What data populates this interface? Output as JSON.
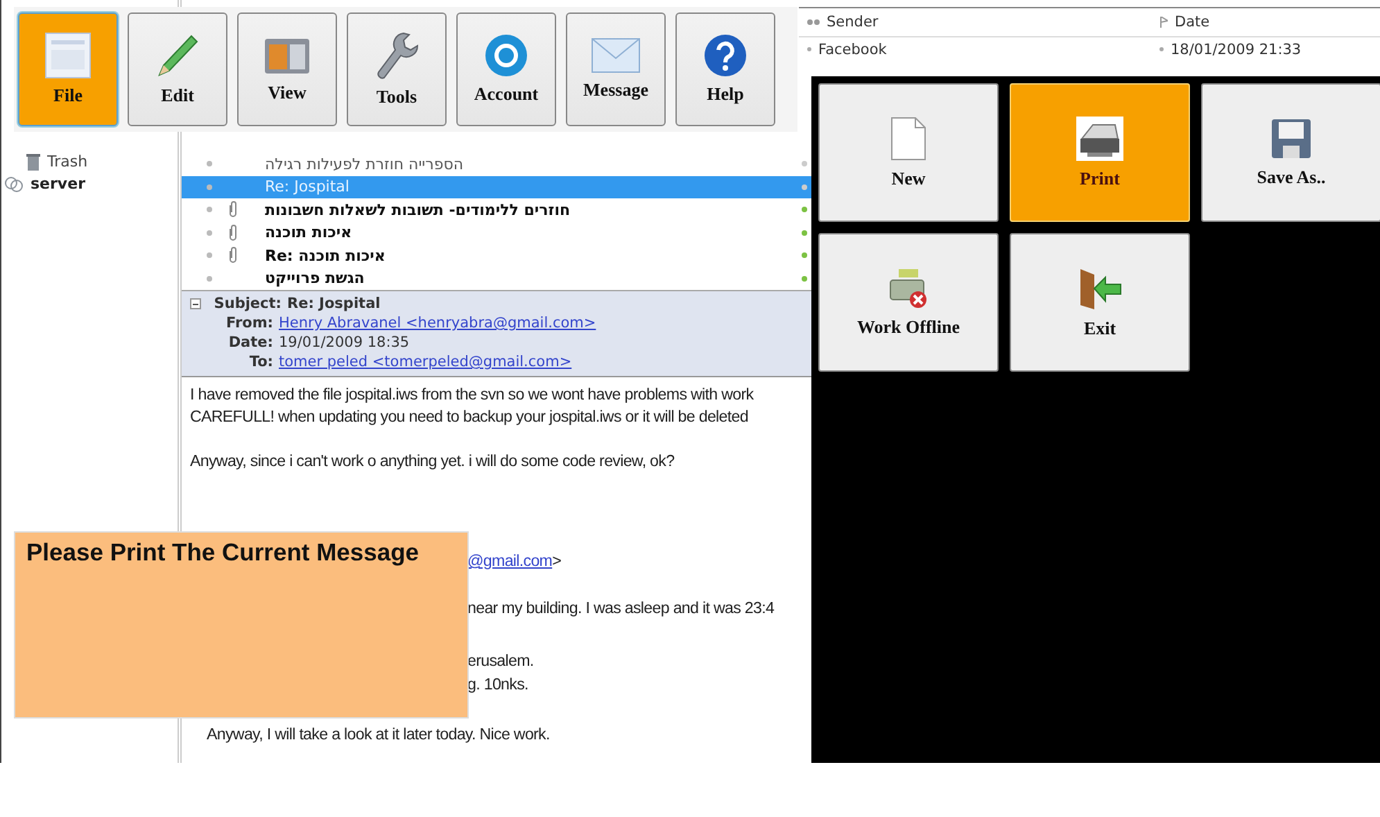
{
  "toolbar": [
    {
      "label": "File",
      "selected": true
    },
    {
      "label": "Edit",
      "selected": false
    },
    {
      "label": "View",
      "selected": false
    },
    {
      "label": "Tools",
      "selected": false
    },
    {
      "label": "Account",
      "selected": false
    },
    {
      "label": "Message",
      "selected": false
    },
    {
      "label": "Help",
      "selected": false
    }
  ],
  "folders": [
    {
      "label": "Trash",
      "kind": "folder"
    },
    {
      "label": "server",
      "kind": "account"
    }
  ],
  "message_list": {
    "rows": [
      {
        "subject": "הספרייה חוזרת לפעילות רגילה",
        "unread": false,
        "attachment": false,
        "selected": false
      },
      {
        "subject": "Re: Jospital",
        "unread": false,
        "attachment": false,
        "selected": true
      },
      {
        "subject": "חוזרים ללימודים- תשובות לשאלות חשבונות",
        "unread": true,
        "attachment": true,
        "selected": false
      },
      {
        "subject": "איכות תוכנה",
        "unread": true,
        "attachment": true,
        "selected": false
      },
      {
        "subject": "Re: איכות תוכנה",
        "unread": true,
        "attachment": true,
        "selected": false
      },
      {
        "subject": "הגשת פרוייקט",
        "unread": true,
        "attachment": false,
        "selected": false
      }
    ]
  },
  "message_header": {
    "fields": [
      {
        "label": "Subject:",
        "value": "Re: Jospital",
        "kind": "bold"
      },
      {
        "label": "From:",
        "value": "Henry Abravanel <henryabra@gmail.com>",
        "kind": "link"
      },
      {
        "label": "Date:",
        "value": "19/01/2009 18:35",
        "kind": "plain"
      },
      {
        "label": "To:",
        "value": "tomer peled <tomerpeled@gmail.com>",
        "kind": "link"
      }
    ]
  },
  "message_body": {
    "lines": [
      {
        "text": "I have removed the file jospital.iws from the svn so we wont have problems with work",
        "kind": "text"
      },
      {
        "text": "CAREFULL! when updating you need to backup your jospital.iws or it will be deleted",
        "kind": "text"
      },
      {
        "text": "Anyway, since i can't work o anything yet. i will do some code review, ok?",
        "kind": "text"
      },
      {
        "text": "@gmail.com",
        "after": ">",
        "kind": "quote-link"
      },
      {
        "text": "near my building. I was asleep and it was 23:4",
        "kind": "quote"
      },
      {
        "text": "erusalem.",
        "kind": "quote"
      },
      {
        "text": "g. 10nks.",
        "kind": "quote"
      },
      {
        "text": "Anyway, I will take a look at it later today. Nice work.",
        "kind": "indent"
      }
    ]
  },
  "sender_list": {
    "columns": [
      "Sender",
      "Date"
    ],
    "rows": [
      {
        "sender": "Facebook",
        "date": "18/01/2009 21:33"
      }
    ]
  },
  "submenu": [
    {
      "label": "New",
      "selected": false
    },
    {
      "label": "Print",
      "selected": true
    },
    {
      "label": "Save As..",
      "selected": false
    },
    {
      "label": "Work Offline",
      "selected": false
    },
    {
      "label": "Exit",
      "selected": false
    }
  ],
  "prompt": {
    "text": "Please Print The Current Message"
  }
}
